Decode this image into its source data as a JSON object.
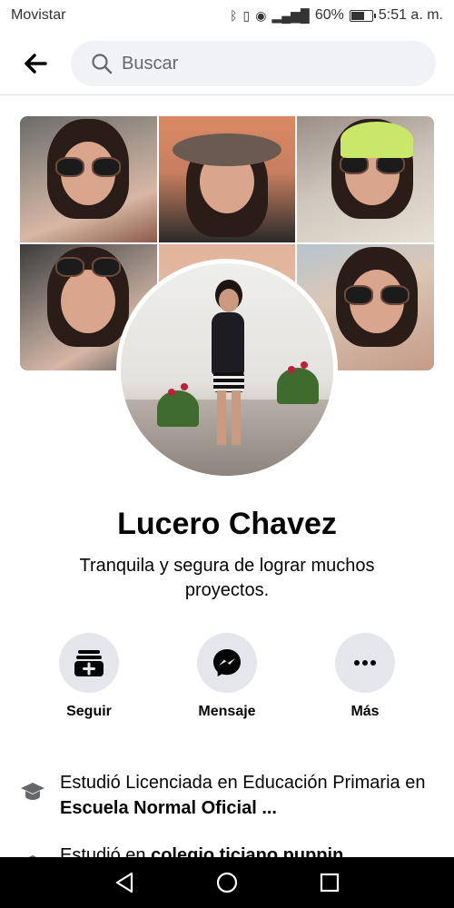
{
  "status_bar": {
    "carrier": "Movistar",
    "battery_percent": "60%",
    "time": "5:51 a. m.",
    "icons": [
      "bluetooth-icon",
      "vibrate-icon",
      "eye-icon",
      "4g-signal-icon",
      "battery-icon"
    ]
  },
  "header": {
    "search_placeholder": "Buscar"
  },
  "profile": {
    "name": "Lucero Chavez",
    "bio": "Tranquila y segura de lograr muchos proyectos."
  },
  "actions": [
    {
      "label": "Seguir",
      "icon": "follow-icon"
    },
    {
      "label": "Mensaje",
      "icon": "messenger-icon"
    },
    {
      "label": "Más",
      "icon": "more-icon"
    }
  ],
  "about": [
    {
      "prefix": "Estudió Licenciada en Educación Primaria en ",
      "bold": "Escuela Normal Oficial ...",
      "icon": "education-icon"
    },
    {
      "prefix": "Estudió en ",
      "bold": "colegio ticiano puppin",
      "icon": "education-icon"
    }
  ],
  "nav_bar": {
    "icons": [
      "back-triangle-icon",
      "home-circle-icon",
      "recents-square-icon"
    ]
  }
}
